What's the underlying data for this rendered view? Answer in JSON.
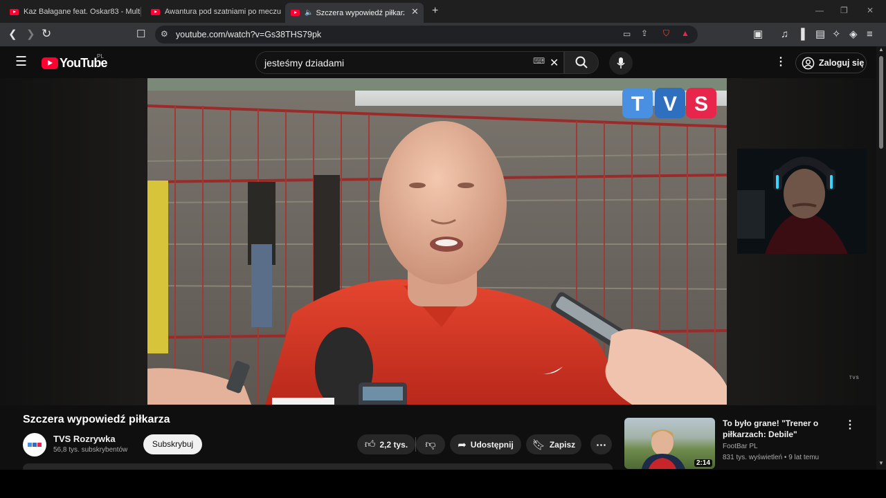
{
  "browser": {
    "tabs": [
      {
        "title": "Kaz Bałagane feat. Oskar83 - Multisp",
        "active": false
      },
      {
        "title": "Awantura pod szatniami po meczu Le",
        "active": false
      },
      {
        "title": "Szczera wypowiedź piłkarza -",
        "active": true
      }
    ],
    "new_tab_icon": "plus-icon",
    "url": "youtube.com/watch?v=Gs38THS79pk"
  },
  "youtube": {
    "logo_text": "YouTube",
    "country_code": "PL",
    "search_value": "jesteśmy dziadami",
    "sign_in_label": "Zaloguj się",
    "video_watermark": "TVS",
    "video": {
      "title": "Szczera wypowiedź piłkarza",
      "channel": "TVS Rozrywka",
      "subscribers": "56,8 tys. subskrybentów",
      "subscribe_label": "Subskrybuj",
      "likes": "2,2 tys.",
      "share_label": "Udostępnij",
      "save_label": "Zapisz"
    },
    "recommendation": {
      "title": "To było grane! \"Trener o piłkarzach: Debile\"",
      "channel": "FootBar PL",
      "meta": "831 tys. wyświetleń • 9 lat temu",
      "duration": "2:14"
    }
  },
  "colors": {
    "youtube_red": "#ff0033",
    "page_bg": "#0f0f0f",
    "tvs_t": "#4a90e2",
    "tvs_v": "#2f6fbf",
    "tvs_s": "#e8264c"
  }
}
